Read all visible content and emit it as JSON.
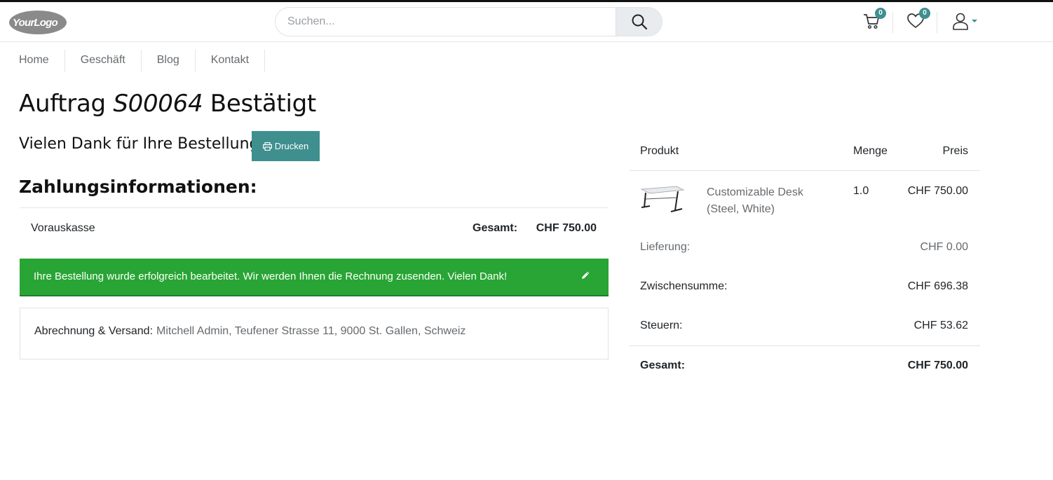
{
  "header": {
    "logo_text": "YourLogo",
    "search_placeholder": "Suchen...",
    "cart_count": "0",
    "wishlist_count": "0"
  },
  "nav": {
    "items": [
      "Home",
      "Geschäft",
      "Blog",
      "Kontakt"
    ]
  },
  "order": {
    "title_prefix": "Auftrag",
    "order_number": "S00064",
    "title_suffix": "Bestätigt",
    "thanks": "Vielen Dank für Ihre Bestellung",
    "print_label": "Drucken",
    "payment_heading": "Zahlungsinformationen:",
    "payment_method": "Vorauskasse",
    "total_label": "Gesamt:",
    "total_value": "CHF 750.00",
    "success_message": "Ihre Bestellung wurde erfolgreich bearbeitet. Wir werden Ihnen die Rechnung zusenden. Vielen Dank!",
    "address_label": "Abrechnung & Versand:",
    "address_value": "Mitchell Admin, Teufener Strasse 11, 9000 St. Gallen, Schweiz"
  },
  "summary": {
    "col_product": "Produkt",
    "col_qty": "Menge",
    "col_price": "Preis",
    "product_name_line1": "Customizable Desk",
    "product_name_line2": "(Steel, White)",
    "product_qty": "1.0",
    "product_price": "CHF 750.00",
    "delivery_label": "Lieferung:",
    "delivery_value": "CHF 0.00",
    "subtotal_label": "Zwischensumme:",
    "subtotal_value": "CHF 696.38",
    "taxes_label": "Steuern:",
    "taxes_value": "CHF 53.62",
    "total_label": "Gesamt:",
    "total_value": "CHF 750.00"
  },
  "colors": {
    "accent": "#3f8f8f",
    "success": "#28a534"
  }
}
